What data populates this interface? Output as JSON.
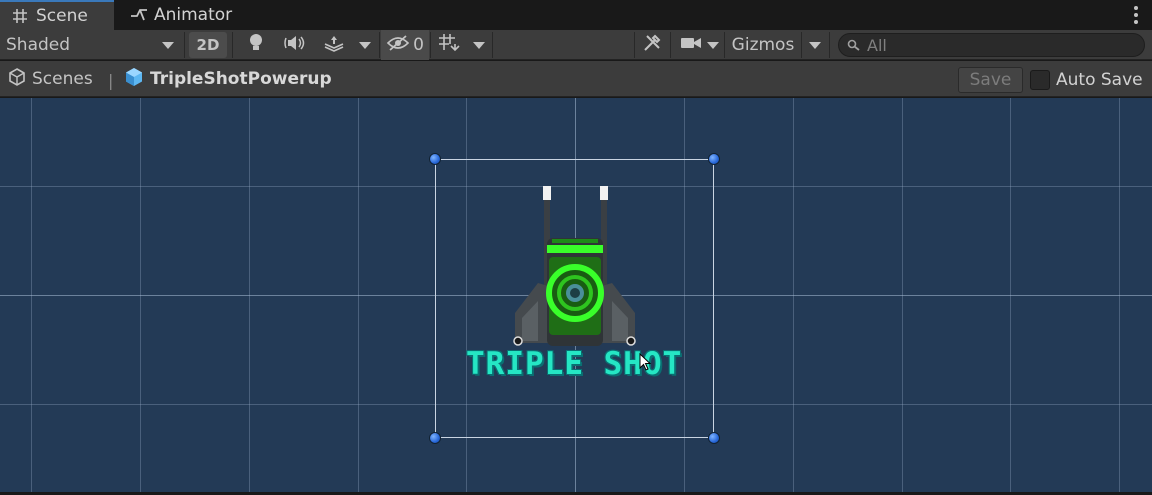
{
  "tabs": [
    {
      "label": "Scene",
      "icon": "grid-hash-icon",
      "active": true
    },
    {
      "label": "Animator",
      "icon": "animator-icon",
      "active": false
    }
  ],
  "toolbar": {
    "draw_mode": "Shaded",
    "mode_2d_label": "2D",
    "hidden_count": "0",
    "gizmos_label": "Gizmos",
    "search_placeholder": "All"
  },
  "breadcrumb": {
    "root": "Scenes",
    "prefab": "TripleShotPowerup"
  },
  "actions": {
    "save_label": "Save",
    "auto_save_label": "Auto Save",
    "auto_save_checked": false
  },
  "scene": {
    "sprite_text": "TRIPLE SHOT",
    "background_color": "#233a56",
    "accent_green": "#39ff2a",
    "text_color": "#25e6c4"
  }
}
